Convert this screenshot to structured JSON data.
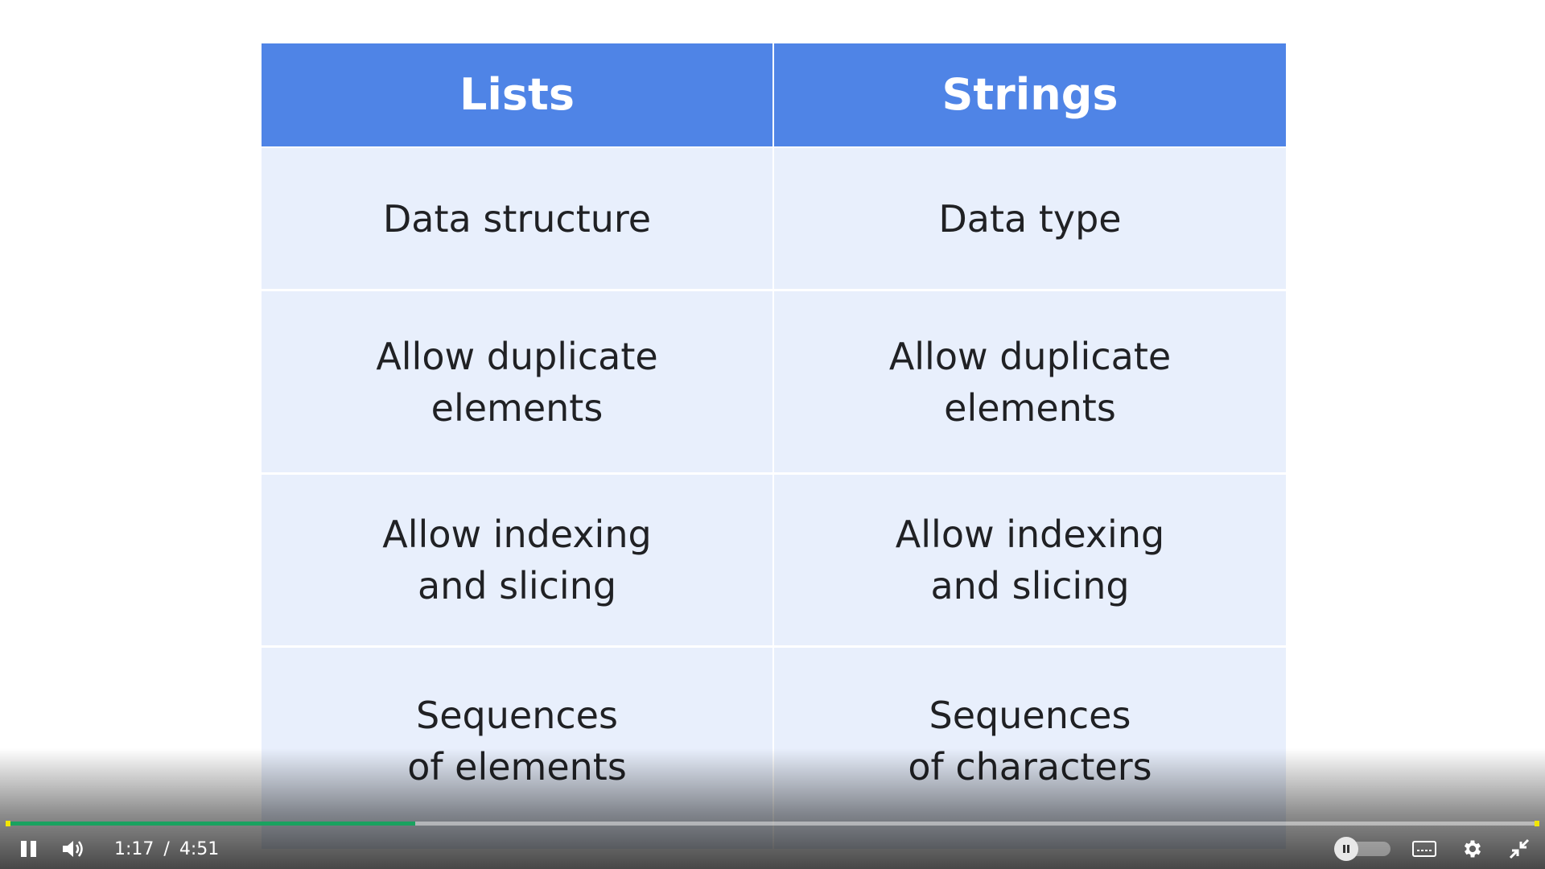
{
  "table": {
    "headers": [
      "Lists",
      "Strings"
    ],
    "rows": [
      [
        "Data structure",
        "Data type"
      ],
      [
        "Allow duplicate\nelements",
        "Allow duplicate\nelements"
      ],
      [
        "Allow indexing\nand slicing",
        "Allow indexing\nand slicing"
      ],
      [
        "Sequences\nof elements",
        "Sequences\nof characters"
      ]
    ]
  },
  "player": {
    "current_time": "1:17",
    "separator": "/",
    "duration": "4:51",
    "progress_fraction": 0.267,
    "progress_color": "#1aa260",
    "marker_color": "#f2e600",
    "icons": {
      "play_pause": "pause-icon",
      "volume": "volume-icon",
      "autoplay_toggle": "autoplay-toggle",
      "captions": "captions-icon",
      "settings": "gear-icon",
      "exit_fullscreen": "exit-fullscreen-icon"
    }
  },
  "colors": {
    "header_bg": "#4f84e6",
    "cell_bg": "#e8effc",
    "text": "#202124"
  }
}
